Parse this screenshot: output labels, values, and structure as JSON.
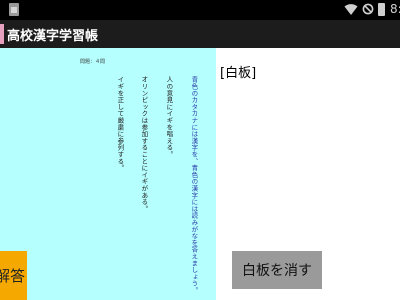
{
  "status_bar": {
    "left_icon": "file-icon",
    "wifi_icon": "wifi-icon",
    "blocked_icon": "no-sign-icon",
    "battery_icon": "battery-icon",
    "time": "8:"
  },
  "app": {
    "icon": "app-icon",
    "title": "高校漢字学習帳"
  },
  "question": {
    "number_label": "問題：４問",
    "columns": [
      {
        "text": "青色のカタカナには漢字を、青色の漢字には読みがなを答えましょう。",
        "color": "blue"
      },
      {
        "text": "人の意見にイギを唱える。",
        "color": "default"
      },
      {
        "text": "オリンピックは参加することにイギがある。",
        "color": "default"
      },
      {
        "text": "イギを正して厳粛に参列する。",
        "color": "default"
      }
    ]
  },
  "buttons": {
    "answer_label": "解答",
    "erase_label": "白板を消す"
  },
  "whiteboard": {
    "label": "[白板]"
  },
  "colors": {
    "question_bg": "#b5ffff",
    "answer_button": "#f4a800",
    "erase_button": "#9a9a9a",
    "action_bar": "#1c1c1c"
  }
}
